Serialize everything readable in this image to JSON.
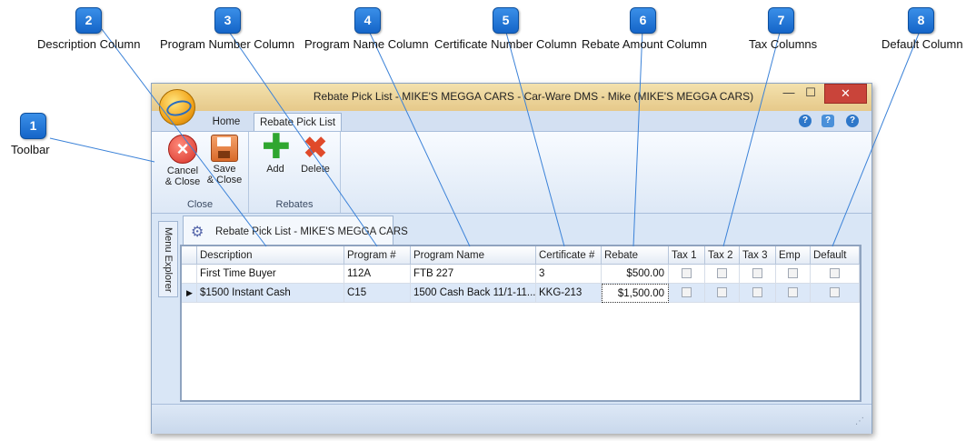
{
  "callouts": [
    {
      "num": "1",
      "label": "Toolbar"
    },
    {
      "num": "2",
      "label": "Description Column"
    },
    {
      "num": "3",
      "label": "Program Number Column"
    },
    {
      "num": "4",
      "label": "Program Name Column"
    },
    {
      "num": "5",
      "label": "Certificate Number Column"
    },
    {
      "num": "6",
      "label": "Rebate Amount Column"
    },
    {
      "num": "7",
      "label": "Tax Columns"
    },
    {
      "num": "8",
      "label": "Default Column"
    }
  ],
  "window": {
    "title": "Rebate Pick List - MIKE'S MEGGA CARS - Car-Ware DMS - Mike (MIKE'S MEGGA CARS)",
    "minimize": "—",
    "maximize": "☐",
    "close": "✕"
  },
  "ribbon": {
    "tabs": [
      "Home",
      "Rebate Pick List"
    ],
    "groups": {
      "close": {
        "label": "Close",
        "cancel": "Cancel & Close",
        "save": "Save & Close"
      },
      "rebates": {
        "label": "Rebates",
        "add": "Add",
        "delete": "Delete"
      }
    },
    "help_icons": [
      "?",
      "?",
      "?"
    ]
  },
  "sidebar": {
    "label": "Menu Explorer"
  },
  "doc_tab": {
    "label": "Rebate Pick List - MIKE'S MEGGA CARS"
  },
  "grid": {
    "columns": [
      "Description",
      "Program #",
      "Program Name",
      "Certificate #",
      "Rebate",
      "Tax 1",
      "Tax 2",
      "Tax 3",
      "Emp",
      "Default"
    ],
    "rows": [
      {
        "description": "First Time Buyer",
        "program_no": "112A",
        "program_name": "FTB 227",
        "certificate": "3",
        "rebate": "$500.00",
        "selected": false
      },
      {
        "description": "$1500 Instant Cash",
        "program_no": "C15",
        "program_name": "1500 Cash Back 11/1-11...",
        "certificate": "KKG-213",
        "rebate": "$1,500.00",
        "selected": true
      }
    ]
  }
}
